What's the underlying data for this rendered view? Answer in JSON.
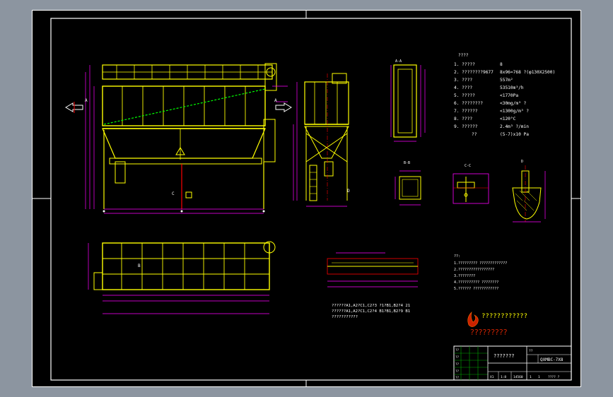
{
  "drawing": {
    "spec_header": "????",
    "spec_rows": [
      {
        "label": "1. ?????",
        "value": "8"
      },
      {
        "label": "2. ????????9677",
        "value": "8x96=768 ?(φ130X2500)"
      },
      {
        "label": "3. ????",
        "value": "557m²"
      },
      {
        "label": "4. ????",
        "value": "53510m³/h"
      },
      {
        "label": "5. ?????",
        "value": "<1770Pa"
      },
      {
        "label": "6. ????????",
        "value": "<30mg/m³ ?"
      },
      {
        "label": "7. ??????",
        "value": "<1300g/m³ ?"
      },
      {
        "label": "8. ????",
        "value": "<120°C"
      },
      {
        "label": "9. ??????",
        "value": "2.4m³ ?/min"
      },
      {
        "label": "??",
        "value": "(5-7)x10 Pa"
      }
    ],
    "parts_note_lines": [
      "??????A1,A2?C1,C2?3 ?1?B1,B2?4 21",
      "??????A1,A2?C1,C2?4 B1?B1,B2?9 B1",
      "???????????"
    ],
    "tech_notes_header": "??:",
    "tech_notes": [
      "1.????????? ?????????????",
      "2.?????????????????",
      "3.????????",
      "4.?????????? ????????",
      "5.?????? ????????????"
    ],
    "logo_text": "????????????",
    "logo_caption": "?????????",
    "title_block": {
      "product_name": "???????",
      "code_label": "??",
      "code": "QXMBC-7X8",
      "row_labels": [
        "??",
        "??",
        "??",
        "??",
        "??"
      ],
      "sheet_info": [
        "1",
        "1",
        "???? ?"
      ],
      "bottom_cells": [
        "X1",
        "1:8",
        "14560"
      ]
    },
    "section_labels": [
      "A-A",
      "B-B",
      "C-C",
      "D"
    ],
    "marks": {
      "left_arrow": "A",
      "right_arrow": "A",
      "c_mark": "C",
      "d_mark": "D",
      "b_mark": "B"
    }
  },
  "colors": {
    "background": "#000000",
    "frame": "#ffffff",
    "equipment": "#ffff00",
    "dimensions": "#ff00ff",
    "centerline": "#ff0000",
    "diagonal": "#00ff00",
    "logo_red": "#cc2200",
    "title_grid": "#00aa00"
  }
}
